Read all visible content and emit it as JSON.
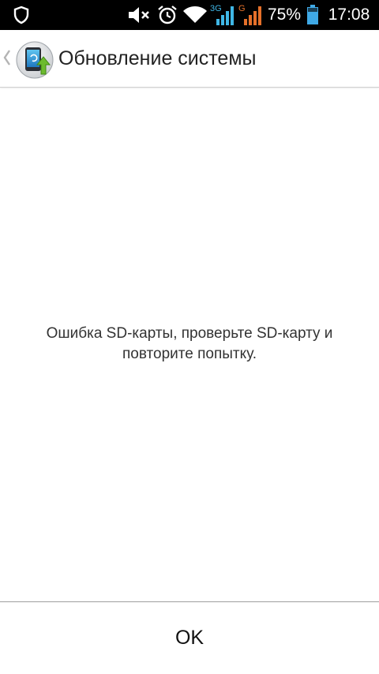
{
  "status_bar": {
    "battery_percent": "75%",
    "time": "17:08",
    "network_1": "3G",
    "network_2": "G",
    "icons": [
      "shield-icon",
      "mute-icon",
      "alarm-icon",
      "wifi-icon",
      "signal-3g-icon",
      "signal-g-icon",
      "battery-icon"
    ],
    "colors": {
      "network_3g": "#3fb7e6",
      "network_g": "#e5702a",
      "battery": "#3fa9e6"
    }
  },
  "action_bar": {
    "title": "Обновление системы",
    "up_icon": "chevron-left-icon",
    "app_icon": "system-update-icon"
  },
  "main": {
    "message": "Ошибка SD-карты, проверьте SD-карту и повторите попытку."
  },
  "footer": {
    "ok_label": "OK"
  }
}
